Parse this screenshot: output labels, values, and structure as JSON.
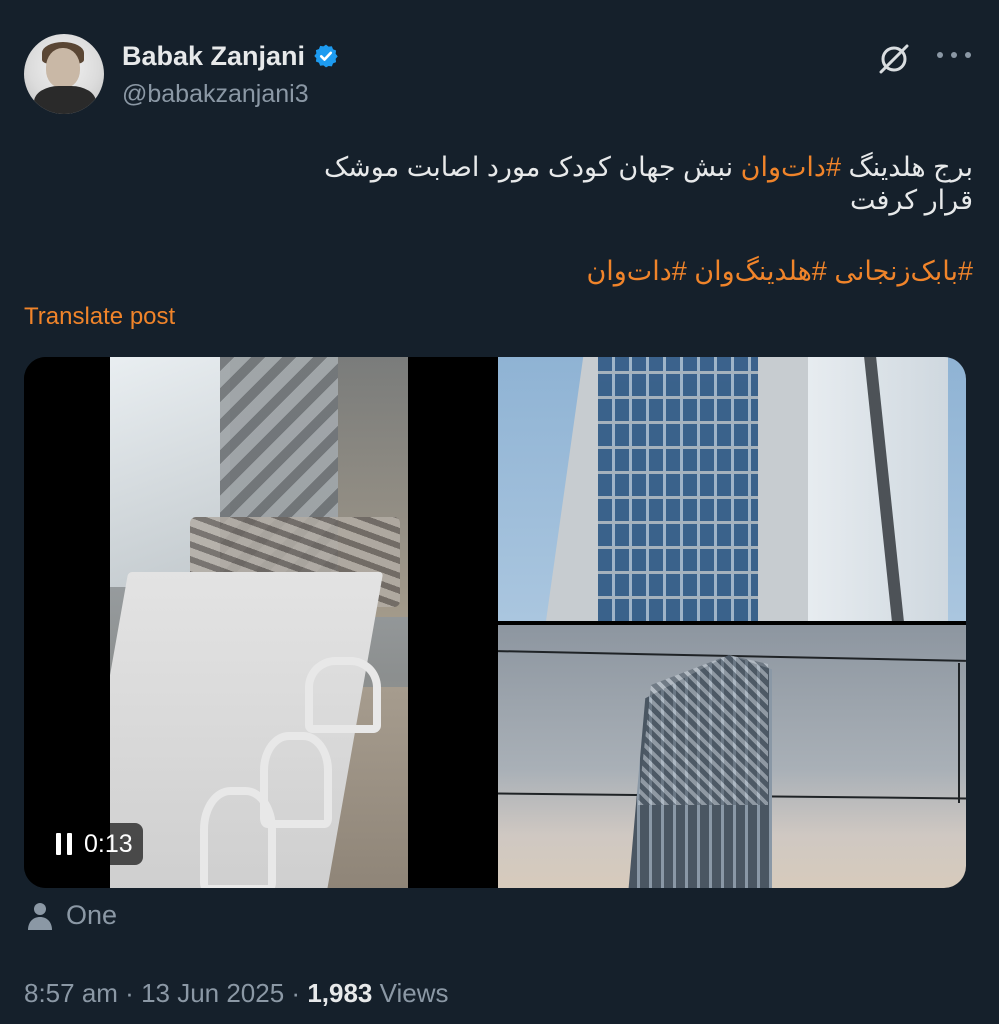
{
  "author": {
    "display_name": "Babak Zanjani",
    "handle": "@babakzanjani3",
    "verified": true
  },
  "post": {
    "line1_prefix": "برج  هلدینگ ",
    "line1_tag": "#دات‌وان",
    "line1_suffix": " نبش جهان کودک مورد اصابت  موشک ",
    "line2": "قرار کرفت",
    "line3_hashtags": "#بابک‌زنجانی #هلدینگ‌وان #دات‌وان"
  },
  "translate_label": "Translate post",
  "video": {
    "timecode": "0:13"
  },
  "location_label": "One",
  "meta": {
    "time": "8:57 am",
    "separator": " · ",
    "date": "13 Jun 2025",
    "views_count": "1,983",
    "views_label": " Views"
  },
  "colors": {
    "background": "#15202b",
    "accent_orange": "#f0842a",
    "verified_blue": "#1d9bf0",
    "secondary_text": "#8b98a5"
  },
  "icons": {
    "verified": "verified-badge-icon",
    "grok": "grok-icon",
    "more": "more-icon",
    "pause": "pause-icon",
    "person": "person-icon"
  }
}
